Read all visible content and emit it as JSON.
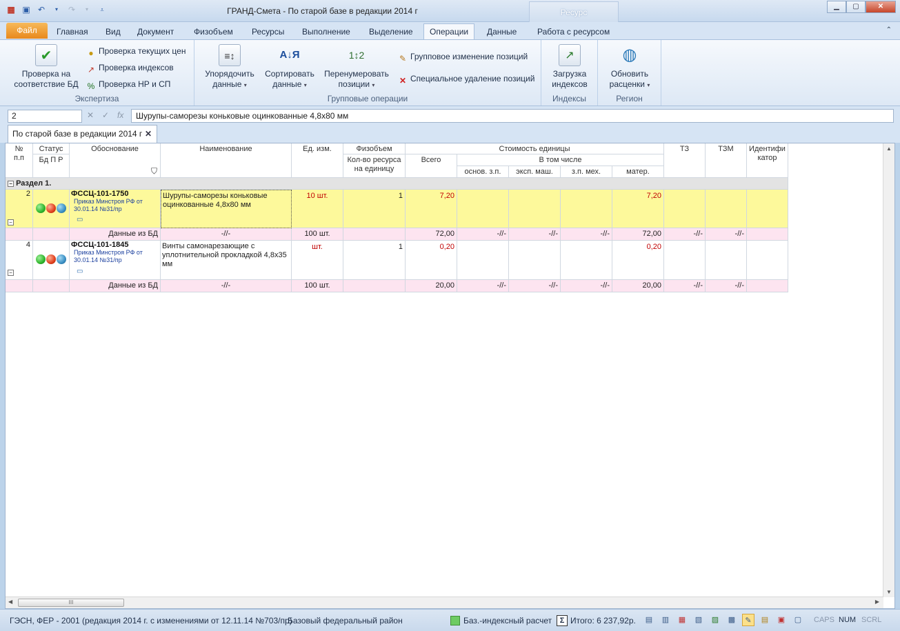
{
  "window": {
    "title": "ГРАНД-Смета - По старой базе в редакции 2014 г",
    "context_tab": "Ресурс"
  },
  "ribbon_tabs": [
    "Файл",
    "Главная",
    "Вид",
    "Документ",
    "Физобъем",
    "Ресурсы",
    "Выполнение",
    "Выделение",
    "Операции",
    "Данные",
    "Работа с ресурсом"
  ],
  "active_tab": "Операции",
  "ribbon": {
    "expertise": {
      "label": "Экспертиза",
      "check_db": "Проверка на\nсоответствие БД",
      "check_prices": "Проверка текущих цен",
      "check_indexes": "Проверка индексов",
      "check_nr_sp": "Проверка НР и СП"
    },
    "group_ops": {
      "label": "Групповые операции",
      "order": "Упорядочить\nданные",
      "sort": "Сортировать\nданные",
      "renumber": "Перенумеровать\nпозиции",
      "group_change": "Групповое изменение позиций",
      "special_delete": "Специальное удаление позиций"
    },
    "indexes": {
      "label": "Индексы",
      "load": "Загрузка\nиндексов"
    },
    "region": {
      "label": "Регион",
      "update": "Обновить\nрасценки"
    }
  },
  "formula_bar": {
    "cell_ref": "2",
    "value": "Шурупы-саморезы коньковые оцинкованные 4,8х80 мм"
  },
  "document_tab": "По старой базе в редакции 2014 г",
  "grid": {
    "headers": {
      "num": "№\nп.п",
      "status": "Статус",
      "status_sub": "Бд  П  Р",
      "basis": "Обоснование",
      "name": "Наименование",
      "unit": "Ед. изм.",
      "phys": "Физобъем",
      "phys_sub": "Кол-во ресурса\nна единицу",
      "unit_cost": "Стоимость единицы",
      "total": "Всего",
      "incl": "В том числе",
      "osn_zp": "основ. з.п.",
      "eksp_mash": "эксп. маш.",
      "zp_meh": "з.п. мех.",
      "mater": "матер.",
      "tz": "ТЗ",
      "tzm": "ТЗМ",
      "ident": "Идентифи\nкатор"
    },
    "section": "Раздел 1.",
    "rows": [
      {
        "num": "2",
        "code": "ФССЦ-101-1750",
        "doc": "Приказ Минстроя РФ от 30.01.14 №31/пр",
        "name": "Шурупы-саморезы коньковые оцинкованные 4,8х80 мм",
        "unit": "10 шт.",
        "qty": "1",
        "total": "7,20",
        "mater": "7,20",
        "db": {
          "label": "Данные из БД",
          "name": "-//-",
          "unit": "100 шт.",
          "total": "72,00",
          "osn": "-//-",
          "eksp": "-//-",
          "zp": "-//-",
          "mater": "72,00",
          "tz": "-//-",
          "tzm": "-//-"
        }
      },
      {
        "num": "4",
        "code": "ФССЦ-101-1845",
        "doc": "Приказ Минстроя РФ от 30.01.14 №31/пр",
        "name": "Винты самонарезающие с уплотнительной прокладкой 4,8х35 мм",
        "unit": "шт.",
        "qty": "1",
        "total": "0,20",
        "mater": "0,20",
        "db": {
          "label": "Данные из БД",
          "name": "-//-",
          "unit": "100 шт.",
          "total": "20,00",
          "osn": "-//-",
          "eksp": "-//-",
          "zp": "-//-",
          "mater": "20,00",
          "tz": "-//-",
          "tzm": "-//-"
        }
      }
    ],
    "scroll_thumb": "III"
  },
  "statusbar": {
    "base": "ГЭСН, ФЕР - 2001 (редакция 2014 г. с изменениями от 12.11.14 №703/пр)",
    "region": "Базовый федеральный район",
    "calc": "Баз.-индексный расчет",
    "total": "Итого: 6 237,92р.",
    "caps": "CAPS",
    "num": "NUM",
    "scrl": "SCRL"
  },
  "colors": {
    "selected_row": "#fdf99b",
    "db_row": "#fde4f0",
    "section_row": "#e3e3e3",
    "red_value": "#c00000",
    "dot_green": "#2fb52c",
    "dot_red": "#e0401d",
    "dot_blue": "#3a8fc4"
  }
}
